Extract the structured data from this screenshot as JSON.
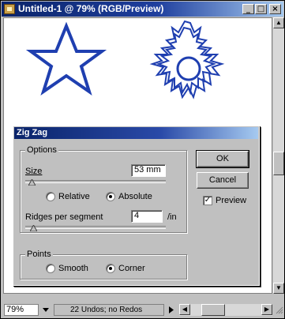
{
  "window": {
    "title": "Untitled-1 @ 79% (RGB/Preview)",
    "minimize_glyph": "_",
    "maximize_glyph": "□",
    "close_glyph": "×"
  },
  "canvas": {
    "shapes": [
      "star",
      "zigzag-star"
    ],
    "stroke_color": "#1f3fb0"
  },
  "dialog": {
    "title": "Zig Zag",
    "options_group": {
      "label": "Options",
      "size_label": "Size",
      "size_value": "53 mm",
      "size_slider_level": 0.05,
      "relative_label": "Relative",
      "absolute_label": "Absolute",
      "size_mode_selected": "Absolute",
      "ridges_label": "Ridges per segment",
      "ridges_value": "4",
      "ridges_slider_level": 0.05,
      "ridges_unit": "/in"
    },
    "points_group": {
      "label": "Points",
      "smooth_label": "Smooth",
      "corner_label": "Corner",
      "selected": "Corner"
    },
    "ok_label": "OK",
    "cancel_label": "Cancel",
    "preview_label": "Preview",
    "preview_checked": true
  },
  "statusbar": {
    "zoom": "79%",
    "status_text": "22 Undos; no Redos"
  }
}
